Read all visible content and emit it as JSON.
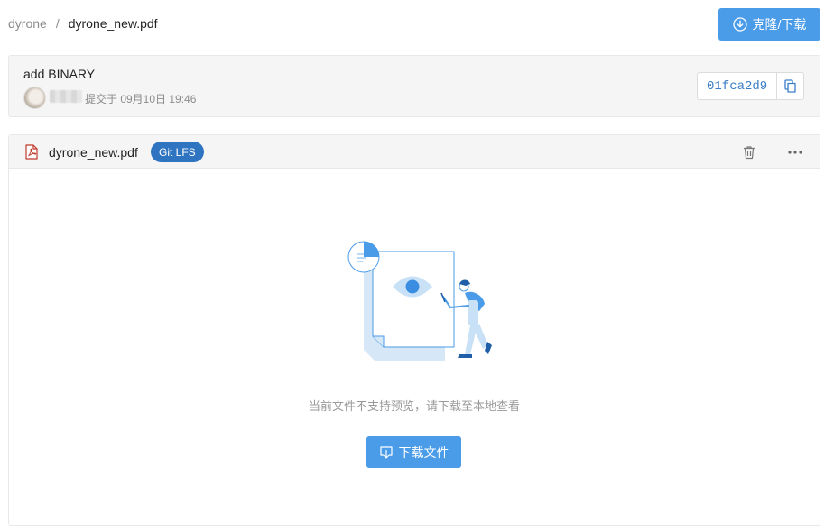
{
  "breadcrumb": {
    "repo": "dyrone",
    "separator": "/",
    "file": "dyrone_new.pdf"
  },
  "header": {
    "clone_label": "克隆/下载"
  },
  "commit": {
    "message": "add BINARY",
    "meta": "提交于 09月10日 19:46",
    "hash": "01fca2d9"
  },
  "file": {
    "name": "dyrone_new.pdf",
    "badge": "Git LFS"
  },
  "preview": {
    "message": "当前文件不支持预览，请下载至本地查看",
    "download_label": "下载文件"
  },
  "icons": {
    "clone": "download-circle-icon",
    "copy": "copy-icon",
    "file": "pdf-file-icon",
    "delete": "trash-icon",
    "more": "more-horizontal-icon",
    "download": "download-box-icon"
  },
  "colors": {
    "primary": "#4a9be8",
    "badge": "#2f74c0",
    "hash": "#3a7ec8",
    "pdf": "#c0392b"
  }
}
